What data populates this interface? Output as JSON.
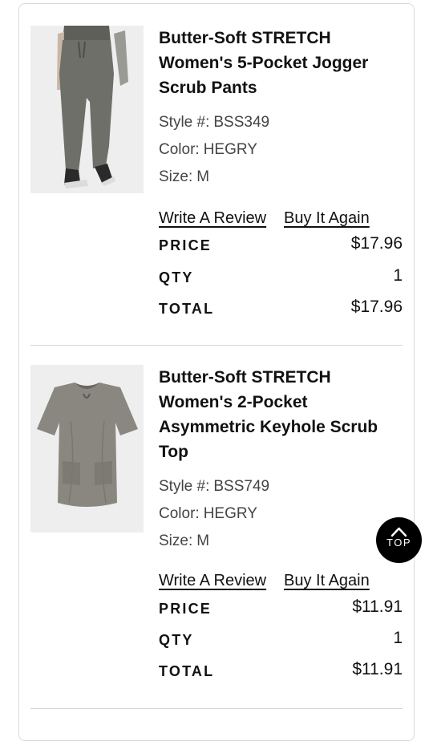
{
  "orders": [
    {
      "image_icon": "jogger-pants-photo",
      "title": "Butter-Soft STRETCH Women's 5-Pocket Jogger Scrub Pants",
      "style_label": "Style #:",
      "style_value": "BSS349",
      "color_label": "Color:",
      "color_value": "HEGRY",
      "size_label": "Size:",
      "size_value": "M",
      "write_review": "Write A Review",
      "buy_again": "Buy It Again",
      "price_label": "PRICE",
      "price_value": "$17.96",
      "qty_label": "QTY",
      "qty_value": "1",
      "total_label": "TOTAL",
      "total_value": "$17.96"
    },
    {
      "image_icon": "scrub-top-photo",
      "title": "Butter-Soft STRETCH Women's 2-Pocket Asymmetric Keyhole Scrub Top",
      "style_label": "Style #:",
      "style_value": "BSS749",
      "color_label": "Color:",
      "color_value": "HEGRY",
      "size_label": "Size:",
      "size_value": "M",
      "write_review": "Write A Review",
      "buy_again": "Buy It Again",
      "price_label": "PRICE",
      "price_value": "$11.91",
      "qty_label": "QTY",
      "qty_value": "1",
      "total_label": "TOTAL",
      "total_value": "$11.91"
    }
  ],
  "top_button": {
    "label": "TOP",
    "icon": "chevron-up-icon"
  },
  "colors": {
    "text": "#111111",
    "divider": "#d6d6d6",
    "thumb_bg": "#eeeeee",
    "top_button_bg": "#000000"
  }
}
